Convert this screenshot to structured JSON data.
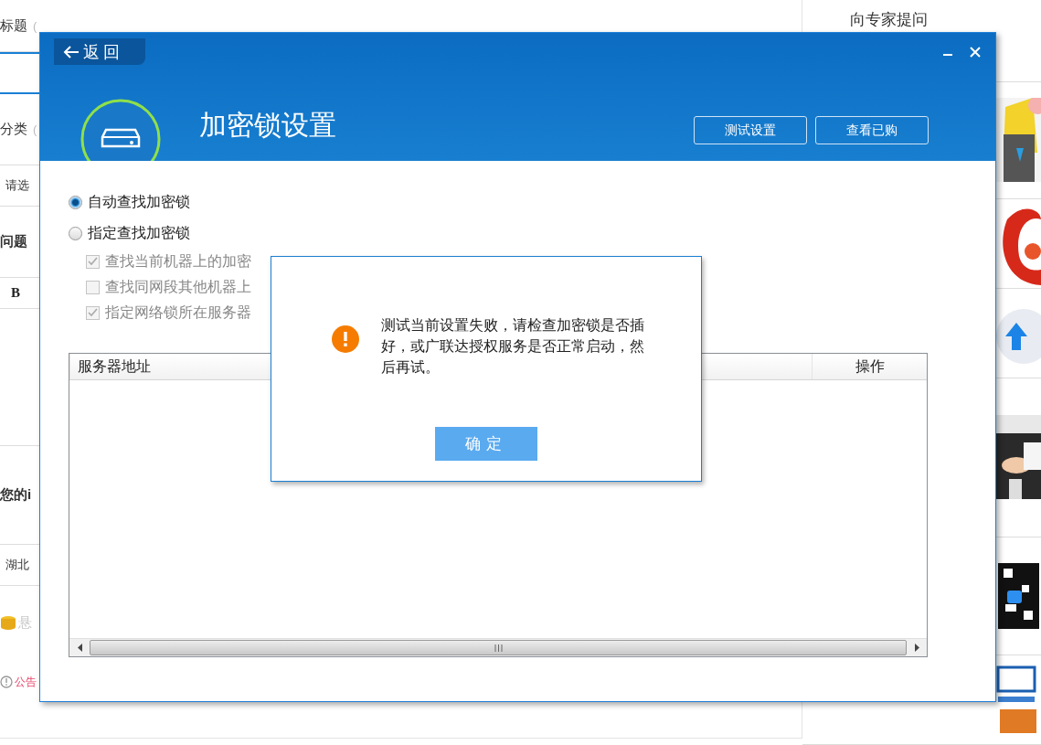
{
  "left_column": [
    {
      "kind": "heading",
      "text": "标题",
      "hint": "("
    },
    {
      "kind": "input"
    },
    {
      "kind": "heading",
      "text": "分类",
      "hint": "("
    },
    {
      "kind": "select",
      "text": "请选"
    },
    {
      "kind": "heading",
      "text": "问题"
    },
    {
      "kind": "editor",
      "text": "B"
    },
    {
      "kind": "heading",
      "text": "您的i"
    },
    {
      "kind": "select",
      "text": "湖北"
    },
    {
      "kind": "reward",
      "text": "悬"
    },
    {
      "kind": "notice",
      "text": "公告"
    }
  ],
  "sidebar": {
    "ask_link": "向专家提问"
  },
  "window": {
    "back": "返回",
    "title": "加密锁设置",
    "header_buttons": [
      "测试设置",
      "查看已购"
    ],
    "search_modes": [
      {
        "label": "自动查找加密锁",
        "selected": true
      },
      {
        "label": "指定查找加密锁",
        "selected": false
      }
    ],
    "options": [
      {
        "label": "查找当前机器上的加密",
        "checked": true,
        "disabled": true
      },
      {
        "label": "查找同网段其他机器上",
        "checked": false,
        "disabled": true
      },
      {
        "label": "指定网络锁所在服务器",
        "checked": true,
        "disabled": true
      }
    ],
    "table": {
      "columns": [
        "服务器地址",
        "操作"
      ]
    }
  },
  "alert": {
    "message": "测试当前设置失败，请检查加密锁是否插好，或广联达授权服务是否正常启动，然后再试。",
    "button": "确定"
  }
}
